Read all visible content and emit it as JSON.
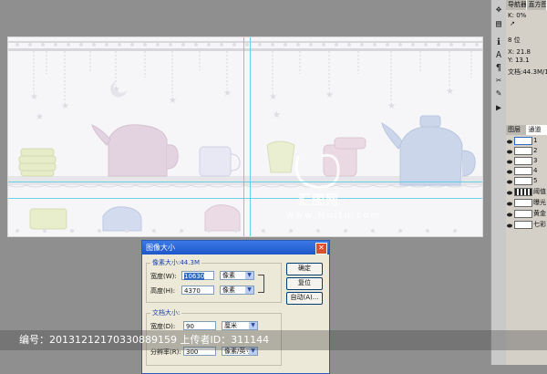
{
  "navigator_tabs": [
    "导航器",
    "直方图",
    "信息"
  ],
  "info_panel": {
    "k_label": "K:",
    "k_value": "0%",
    "bit_depth": "8 位",
    "x_label": "X:",
    "x_value": "21.8",
    "y_label": "Y:",
    "y_value": "13.1",
    "doc_size": "文档:44.3M/160"
  },
  "layers_tabs": [
    "图层",
    "通道",
    "路径"
  ],
  "layers": [
    {
      "name": "1"
    },
    {
      "name": "2"
    },
    {
      "name": "3"
    },
    {
      "name": "4"
    },
    {
      "name": "5"
    },
    {
      "name": "阈值"
    },
    {
      "name": "曝光"
    },
    {
      "name": "黄金"
    },
    {
      "name": "七彩"
    }
  ],
  "dialog": {
    "title": "图像大小",
    "pixel_group_title": "像素大小:44.3M",
    "width_label": "宽度(W):",
    "width_value": "10630",
    "width_unit": "像素",
    "height_label": "高度(H):",
    "height_value": "4370",
    "height_unit": "像素",
    "doc_group_title": "文档大小:",
    "doc_width_label": "宽度(D):",
    "doc_width_value": "90",
    "doc_width_unit": "厘米",
    "resolution_label": "分辨率(R):",
    "resolution_value": "300",
    "resolution_unit": "像素/英寸",
    "ok_button": "确定",
    "reset_button": "复位",
    "auto_button": "自动(A)..."
  },
  "watermark": {
    "brand": "汇图网",
    "url": "www.Huitu.com",
    "footer": "编号：20131212170330889159 上传者ID：311144"
  },
  "colors": {
    "canvas_bg": "#8f8f8f",
    "document_bg": "#f6f6f8",
    "guide": "#49c9e0",
    "dialog_title": "#1d56c8"
  }
}
